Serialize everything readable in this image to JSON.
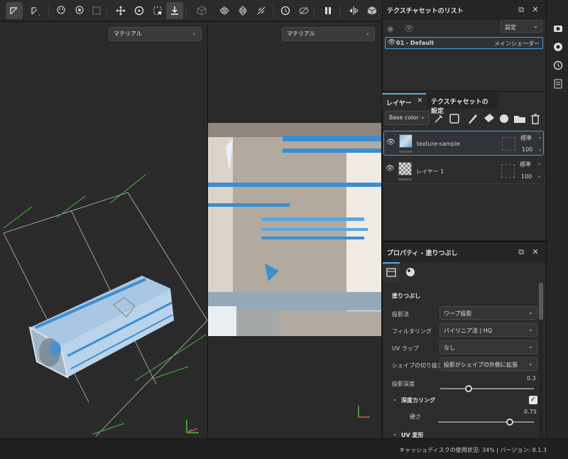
{
  "toolbar": {
    "icons": [
      "transform-icon",
      "transform-options-icon",
      "mask-icon",
      "mask-options-icon",
      "camera-fit-icon",
      "move-icon",
      "rotate-icon",
      "frame-icon",
      "bake-icon",
      "cube-icon",
      "mirror-x-icon",
      "mirror-y-icon",
      "symmetry-icon",
      "history-icon",
      "eye-off-icon",
      "pause-icon",
      "layout-split-icon",
      "view-cube-icon"
    ]
  },
  "viewport3d": {
    "material_select": "マテリアル"
  },
  "viewport2d": {
    "material_select": "マテリアル"
  },
  "texture_set_list": {
    "title": "テクスチャセットのリスト",
    "settings_label": "設定",
    "items": [
      {
        "name": "01 - Default",
        "shader": "メインシェーダー"
      }
    ]
  },
  "layers_panel": {
    "tabs": [
      {
        "label": "レイヤー"
      },
      {
        "label": "テクスチャセットの設定"
      }
    ],
    "channel_select": "Base color",
    "layers": [
      {
        "name": "texture-sample",
        "blend": "標準",
        "opacity": "100"
      },
      {
        "name": "レイヤー 1",
        "blend": "標準",
        "opacity": "100"
      }
    ]
  },
  "properties": {
    "title": "プロパティ - 塗りつぶし",
    "section_fill": "塗りつぶし",
    "projection": {
      "label": "投影法",
      "value": "ワープ投影"
    },
    "filtering": {
      "label": "フィルタリング",
      "value": "バイリニア法 | HQ"
    },
    "uv_wrap": {
      "label": "UV ラップ",
      "value": "なし"
    },
    "shape_crop": {
      "label": "シェイプの切り抜き",
      "value": "投影がシェイプの外側に拡張"
    },
    "projection_depth": {
      "label": "投影深度",
      "value": "0.3",
      "fraction": 0.3
    },
    "depth_culling": {
      "label": "深度カリング",
      "checked": true
    },
    "hardness": {
      "label": "硬さ",
      "value": "0.75",
      "fraction": 0.75
    },
    "uv_transform": {
      "label": "UV 変形"
    }
  },
  "status": {
    "text": "キャッシュディスクの使用状況: 34% | バージョン: 8.1.3"
  },
  "colors": {
    "accent": "#4a9bd8",
    "gizmo_green": "#3fbf3f",
    "mesh_blue": "#3d8fd1"
  }
}
